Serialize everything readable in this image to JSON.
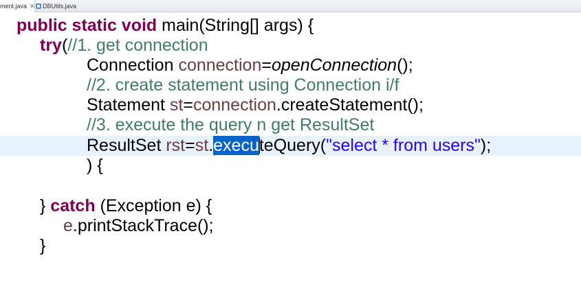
{
  "tabs": [
    {
      "label": "ment.java",
      "close": "✕",
      "active": true
    },
    {
      "label": "DBUtils.java",
      "active": false
    }
  ],
  "code": {
    "line1": {
      "kw": "public static void",
      "rest": " main(String[] args) {"
    },
    "line2": {
      "kw": "try",
      "paren": "(",
      "comment": "//1. get connection"
    },
    "line3": {
      "type": "Connection ",
      "var": "connection",
      "eq": "=",
      "method": "openConnection",
      "end": "();"
    },
    "line4": {
      "comment": "//2. create statement using Connection i/f"
    },
    "line5": {
      "type": "Statement ",
      "var1": "st",
      "eq": "=",
      "var2": "connection",
      "rest": ".createStatement();"
    },
    "line6": {
      "comment": "//3. execute the query n get ResultSet"
    },
    "line7": {
      "type": "ResultSet ",
      "var1": "rst",
      "eq": "=",
      "var2": "st",
      "dot": ".",
      "selected": "execu",
      "after_sel": "teQuery(",
      "string": "\"select * from users\"",
      "end": ");"
    },
    "line8": {
      "text": ") {"
    },
    "line9": {
      "text": ""
    },
    "line10": {
      "brace": "} ",
      "kw": "catch",
      "rest": " (Exception e) {"
    },
    "line11": {
      "var": "e",
      "rest": ".printStackTrace();"
    },
    "line12": {
      "text": "}"
    }
  },
  "colors": {
    "keyword": "#7f0055",
    "comment": "#3f7f5f",
    "local_variable": "#6a3e3e",
    "string": "#2a00ff",
    "selection": "#0a64c8",
    "current_line": "#e8f2fe"
  }
}
